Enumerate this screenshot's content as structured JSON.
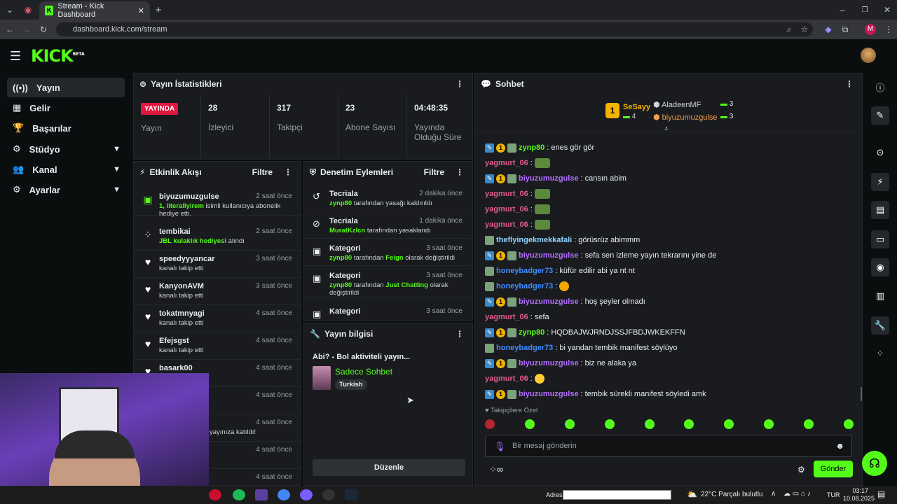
{
  "browser": {
    "tab_title": "Stream - Kick Dashboard",
    "url": "dashboard.kick.com/stream",
    "profile_letter": "M"
  },
  "header": {
    "logo": "KICK",
    "beta": "BETA"
  },
  "sidebar": {
    "items": [
      {
        "label": "Yayın",
        "icon": "broadcast-icon"
      },
      {
        "label": "Gelir",
        "icon": "chart-icon"
      },
      {
        "label": "Başarılar",
        "icon": "trophy-icon"
      },
      {
        "label": "Stüdyo",
        "icon": "gear-icon"
      },
      {
        "label": "Kanal",
        "icon": "users-icon"
      },
      {
        "label": "Ayarlar",
        "icon": "settings-icon"
      }
    ]
  },
  "stats": {
    "title": "Yayın İstatistikleri",
    "live": "YAYINDA",
    "live_label": "Yayın",
    "items": [
      {
        "value": "28",
        "label": "İzleyici"
      },
      {
        "value": "317",
        "label": "Takipçi"
      },
      {
        "value": "23",
        "label": "Abone Sayısı"
      },
      {
        "value": "04:48:35",
        "label": "Yayında Olduğu Süre"
      }
    ]
  },
  "activity": {
    "title": "Etkinlik Akışı",
    "filter": "Filtre",
    "events": [
      {
        "name": "biyuzumuzgulse",
        "time": "2 saat önce",
        "hl": "1, literallyirem",
        "desc": " isimli kullanıcıya abonelik hediye etti."
      },
      {
        "name": "tembikai",
        "time": "2 saat önce",
        "hl": "JBL kulaklık hediyesi",
        "desc": " alındı"
      },
      {
        "name": "speedyyyancar",
        "time": "3 saat önce",
        "hl": "",
        "desc": "kanalı takip etti"
      },
      {
        "name": "KanyonAVM",
        "time": "3 saat önce",
        "hl": "",
        "desc": "kanalı takip etti"
      },
      {
        "name": "tokatmnyagi",
        "time": "4 saat önce",
        "hl": "",
        "desc": "kanalı takip etti"
      },
      {
        "name": "Efejsgst",
        "time": "4 saat önce",
        "hl": "",
        "desc": "kanalı takip etti"
      },
      {
        "name": "basark00",
        "time": "4 saat önce",
        "hl": "",
        "desc": ""
      },
      {
        "name": "",
        "time": "4 saat önce",
        "hl": "",
        "desc": ""
      },
      {
        "name": "",
        "time": "4 saat önce",
        "hl": "",
        "desc": "yayınıza katıldı!"
      },
      {
        "name": "",
        "time": "4 saat önce",
        "hl": "",
        "desc": ""
      },
      {
        "name": "",
        "time": "4 saat önce",
        "hl": "",
        "desc": ""
      }
    ]
  },
  "moderation": {
    "title": "Denetim Eylemleri",
    "filter": "Filtre",
    "items": [
      {
        "name": "Tecriala",
        "time": "2 dakika önce",
        "hl": "zynp80",
        "desc": " tarafından yasağı kaldırıldı",
        "hl2": "",
        "desc2": ""
      },
      {
        "name": "Tecriala",
        "time": "1 dakika önce",
        "hl": "MuratKzlcn",
        "desc": " tarafından yasaklandı",
        "hl2": "",
        "desc2": ""
      },
      {
        "name": "Kategori",
        "time": "3 saat önce",
        "hl": "zynp80",
        "desc": " tarafından ",
        "hl2": "Feign",
        "desc2": " olarak değiştirildi"
      },
      {
        "name": "Kategori",
        "time": "3 saat önce",
        "hl": "zynp80",
        "desc": " tarafından ",
        "hl2": "Just Chatting",
        "desc2": " olarak değiştirildi"
      },
      {
        "name": "Kategori",
        "time": "3 saat önce",
        "hl": "",
        "desc": "",
        "hl2": "",
        "desc2": ""
      }
    ]
  },
  "streaminfo": {
    "title": "Yayın bilgisi",
    "stream_title": "Abi? - Bol aktiviteli yayın...",
    "category": "Sadece Sohbet",
    "tag": "Turkish",
    "edit": "Düzenle"
  },
  "chat": {
    "title": "Sohbet",
    "leader": {
      "first_name": "SeSayy",
      "first_count": "4",
      "second_name": "AladeenMF",
      "second_count": "3",
      "third_name": "biyuzumuzgulse",
      "third_count": "3"
    },
    "messages": [
      {
        "badges": [
          "b1",
          "b2",
          "b3"
        ],
        "user": "zynp80",
        "color": "#53fc18",
        "text": "enes gör gör",
        "emote": ""
      },
      {
        "badges": [],
        "user": "yagmurt_06",
        "color": "#e05a8a",
        "text": "",
        "emote": "rect"
      },
      {
        "badges": [
          "b1",
          "b2",
          "b3"
        ],
        "user": "biyuzumuzgulse",
        "color": "#b36cff",
        "text": "cansın abim",
        "emote": ""
      },
      {
        "badges": [],
        "user": "yagmurt_06",
        "color": "#e05a8a",
        "text": "",
        "emote": "rect"
      },
      {
        "badges": [],
        "user": "yagmurt_06",
        "color": "#e05a8a",
        "text": "",
        "emote": "rect"
      },
      {
        "badges": [],
        "user": "yagmurt_06",
        "color": "#e05a8a",
        "text": "",
        "emote": "rect"
      },
      {
        "badges": [
          "b3"
        ],
        "user": "theflyingekmekkafali",
        "color": "#8fd6ff",
        "text": "görüsrüz abimmm",
        "emote": ""
      },
      {
        "badges": [
          "b1",
          "b2",
          "b3"
        ],
        "user": "biyuzumuzgulse",
        "color": "#b36cff",
        "text": "sefa sen izleme yayın tekrarını yine de",
        "emote": ""
      },
      {
        "badges": [
          "b3"
        ],
        "user": "honeybadger73",
        "color": "#3f8cff",
        "text": "küfür edilir abi ya nt nt",
        "emote": ""
      },
      {
        "badges": [
          "b3"
        ],
        "user": "honeybadger73",
        "color": "#3f8cff",
        "text": "",
        "emote": "hand"
      },
      {
        "badges": [
          "b1",
          "b2",
          "b3"
        ],
        "user": "biyuzumuzgulse",
        "color": "#b36cff",
        "text": "hoş şeyler olmadı",
        "emote": ""
      },
      {
        "badges": [],
        "user": "yagmurt_06",
        "color": "#e05a8a",
        "text": "sefa",
        "emote": ""
      },
      {
        "badges": [
          "b1",
          "b2",
          "b3"
        ],
        "user": "zynp80",
        "color": "#53fc18",
        "text": "HQDBAJWJRNDJSSJFBDJWKEKFFN",
        "emote": ""
      },
      {
        "badges": [
          "b3"
        ],
        "user": "honeybadger73",
        "color": "#3f8cff",
        "text": "bi yandan tembik manifest söylüyo",
        "emote": ""
      },
      {
        "badges": [
          "b1",
          "b2",
          "b3"
        ],
        "user": "biyuzumuzgulse",
        "color": "#b36cff",
        "text": "biz ne alaka ya",
        "emote": ""
      },
      {
        "badges": [],
        "user": "yagmurt_06",
        "color": "#e05a8a",
        "text": "",
        "emote": "smile"
      },
      {
        "badges": [
          "b1",
          "b2",
          "b3"
        ],
        "user": "biyuzumuzgulse",
        "color": "#b36cff",
        "text": "tembik sürekli manifest söyledi amk",
        "emote": ""
      }
    ],
    "followers_only": "Takipçilere Özel",
    "placeholder": "Bir mesaj gönderin",
    "send": "Gönder"
  },
  "taskbar": {
    "address_label": "Adres",
    "weather": "22°C  Parçalı bulutlu",
    "lang": "TUR",
    "time": "03:17",
    "date": "10.08.2025"
  }
}
